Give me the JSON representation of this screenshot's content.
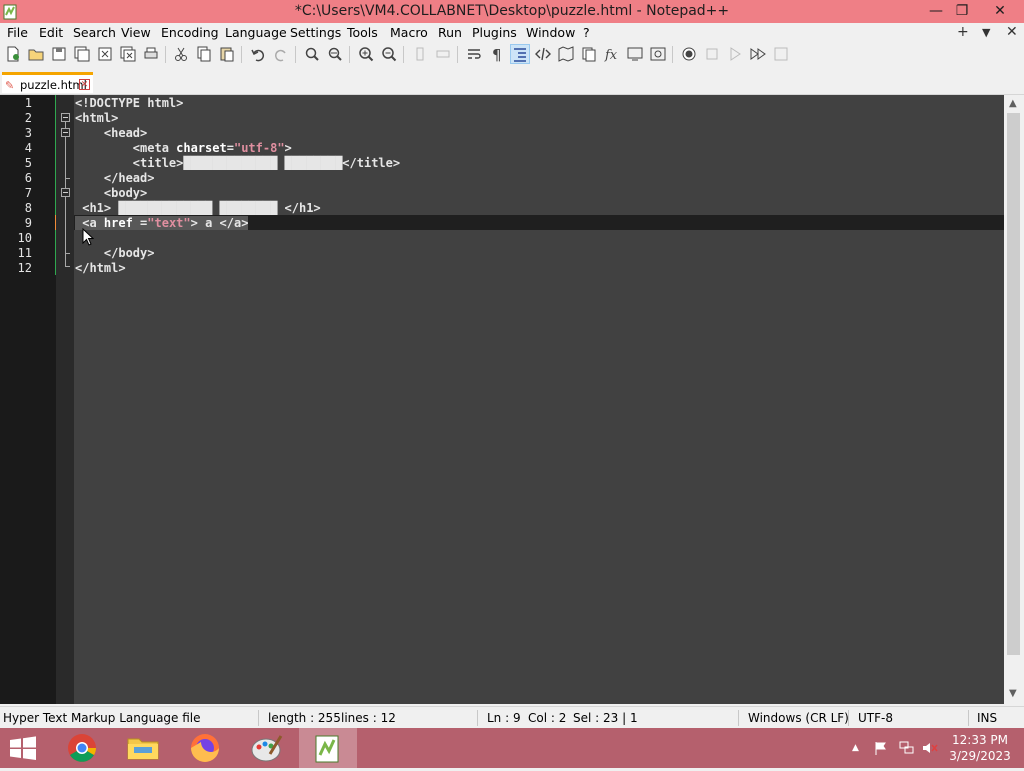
{
  "window": {
    "title": "*C:\\Users\\VM4.COLLABNET\\Desktop\\puzzle.html - Notepad++",
    "controls": {
      "minimize": "—",
      "restore": "❐",
      "close": "✕"
    }
  },
  "menu": {
    "items": [
      "File",
      "Edit",
      "Search",
      "View",
      "Encoding",
      "Language",
      "Settings",
      "Tools",
      "Macro",
      "Run",
      "Plugins",
      "Window",
      "?"
    ],
    "right": {
      "add": "+",
      "dropdown": "▼",
      "close": "✕"
    }
  },
  "tab": {
    "label": "puzzle.html",
    "modified": true
  },
  "editor": {
    "line_numbers": [
      "1",
      "2",
      "3",
      "4",
      "5",
      "6",
      "7",
      "8",
      "9",
      "10",
      "11",
      "12"
    ],
    "current_line": "9",
    "lines": [
      {
        "text": "<!DOCTYPE html>"
      },
      {
        "text": "<html>"
      },
      {
        "text": "    <head>"
      },
      {
        "pre": "        <meta ",
        "attr": "charset",
        "eq": "=",
        "str": "\"utf-8\"",
        "post": ">"
      },
      {
        "text": "        <title>█████████████ ████████</title>"
      },
      {
        "text": "    </head>"
      },
      {
        "text": "    <body>"
      },
      {
        "text": " <h1> █████████████ ████████ </h1>"
      },
      {
        "pre": " <a ",
        "attr": "href",
        "eq": " =",
        "str": "\"text\"",
        "post": "> a </a>"
      },
      {
        "text": ""
      },
      {
        "text": "    </body>"
      },
      {
        "text": "</html>"
      }
    ]
  },
  "status": {
    "file_type": "Hyper Text Markup Language file",
    "length": "length : 255",
    "lines": "lines : 12",
    "ln": "Ln : 9",
    "col": "Col : 2",
    "sel": "Sel : 23 | 1",
    "eol": "Windows (CR LF)",
    "encoding": "UTF-8",
    "mode": "INS"
  },
  "taskbar": {
    "apps": [
      "start-icon",
      "chrome-icon",
      "file-explorer-icon",
      "firefox-icon",
      "paint-icon",
      "notepadpp-icon"
    ],
    "time": "12:33 PM",
    "date": "3/29/2023"
  },
  "colors": {
    "titlebar": "#ef7f86",
    "taskbar": "#b5606d",
    "editor_bg": "#414141",
    "string": "#e08fa0"
  }
}
